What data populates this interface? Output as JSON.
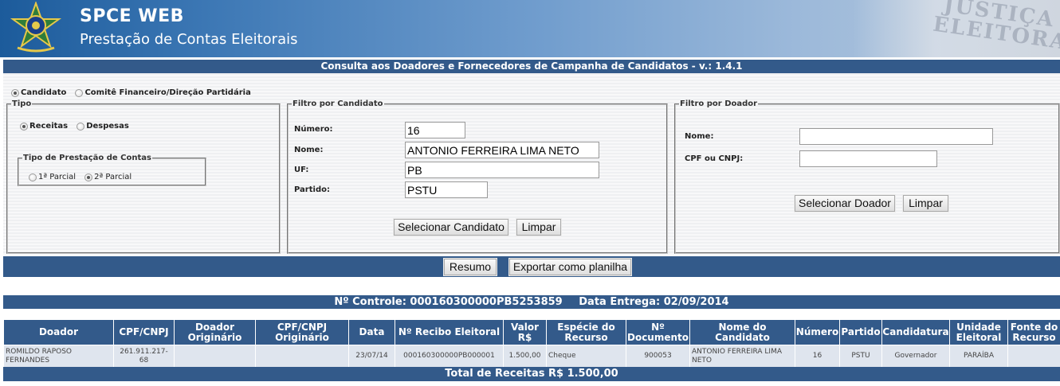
{
  "header": {
    "app_title": "SPCE WEB",
    "app_subtitle": "Prestação de Contas Eleitorais",
    "deco_text": "JUSTIÇA ELEITORAL"
  },
  "page_title": "Consulta aos Doadores e Fornecedores de Campanha de Candidatos - v.: 1.4.1",
  "entity_type": {
    "options": [
      {
        "label": "Candidato",
        "selected": true
      },
      {
        "label": "Comitê Financeiro/Direção Partidária",
        "selected": false
      }
    ]
  },
  "tipo": {
    "legend": "Tipo",
    "options": [
      {
        "label": "Receitas",
        "selected": true
      },
      {
        "label": "Despesas",
        "selected": false
      }
    ],
    "prestacao": {
      "legend": "Tipo de Prestação de Contas",
      "options": [
        {
          "label": "1ª Parcial",
          "selected": false
        },
        {
          "label": "2ª Parcial",
          "selected": true
        }
      ]
    }
  },
  "filtro_candidato": {
    "legend": "Filtro por Candidato",
    "numero_label": "Número:",
    "numero_value": "16",
    "nome_label": "Nome:",
    "nome_value": "ANTONIO FERREIRA LIMA NETO",
    "uf_label": "UF:",
    "uf_value": "PB",
    "partido_label": "Partido:",
    "partido_value": "PSTU",
    "select_button": "Selecionar Candidato",
    "clear_button": "Limpar"
  },
  "filtro_doador": {
    "legend": "Filtro por Doador",
    "nome_label": "Nome:",
    "nome_value": "",
    "cpf_label": "CPF ou CNPJ:",
    "cpf_value": "",
    "select_button": "Selecionar Doador",
    "clear_button": "Limpar"
  },
  "actions": {
    "resumo": "Resumo",
    "exportar": "Exportar como planilha"
  },
  "result": {
    "controle": "Nº Controle: 000160300000PB5253859",
    "data_entrega": "Data Entrega: 02/09/2014",
    "columns": [
      "Doador",
      "CPF/CNPJ",
      "Doador Originário",
      "CPF/CNPJ Originário",
      "Data",
      "Nº Recibo Eleitoral",
      "Valor R$",
      "Espécie do Recurso",
      "Nº Documento",
      "Nome do Candidato",
      "Número",
      "Partido",
      "Candidatura",
      "Unidade Eleitoral",
      "Fonte do Recurso"
    ],
    "rows": [
      [
        "ROMILDO RAPOSO FERNANDES",
        "261.911.217-68",
        "",
        "",
        "23/07/14",
        "000160300000PB000001",
        "1.500,00",
        "Cheque",
        "900053",
        "ANTONIO FERREIRA LIMA NETO",
        "16",
        "PSTU",
        "Governador",
        "PARAÍBA",
        ""
      ]
    ],
    "total": "Total de Receitas R$ 1.500,00"
  },
  "colors": {
    "bar_blue": "#335a8a",
    "row_bg": "#dfe5ee"
  }
}
